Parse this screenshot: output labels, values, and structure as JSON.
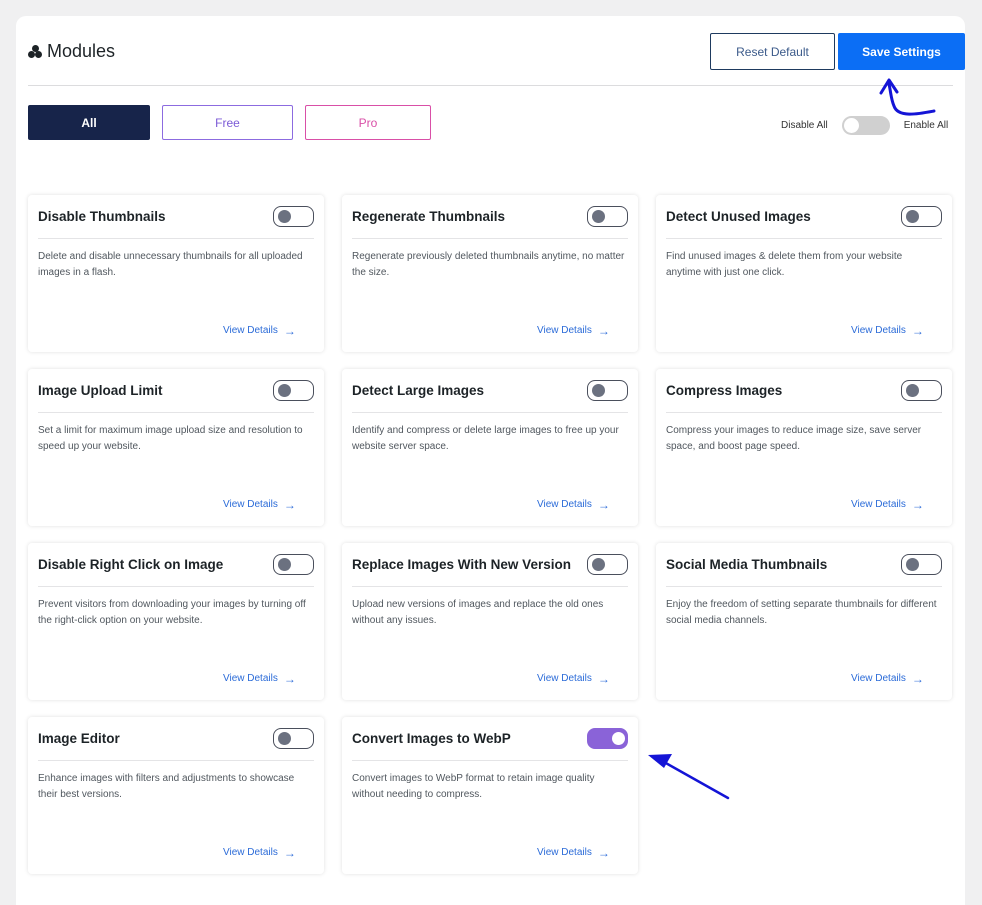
{
  "header": {
    "title": "Modules",
    "reset_label": "Reset Default",
    "save_label": "Save Settings"
  },
  "filters": {
    "all": "All",
    "free": "Free",
    "pro": "Pro"
  },
  "master_toggle": {
    "disable_label": "Disable All",
    "enable_label": "Enable All",
    "state": "off"
  },
  "modules": [
    {
      "title": "Disable Thumbnails",
      "desc": "Delete and disable unnecessary thumbnails for all uploaded images in a flash.",
      "link": "View Details",
      "enabled": false
    },
    {
      "title": "Regenerate Thumbnails",
      "desc": "Regenerate previously deleted thumbnails anytime, no matter the size.",
      "link": "View Details",
      "enabled": false
    },
    {
      "title": "Detect Unused Images",
      "desc": "Find unused images & delete them from your website anytime with just one click.",
      "link": "View Details",
      "enabled": false
    },
    {
      "title": "Image Upload Limit",
      "desc": "Set a limit for maximum image upload size and resolution to speed up your website.",
      "link": "View Details",
      "enabled": false
    },
    {
      "title": "Detect Large Images",
      "desc": "Identify and compress or delete large images to free up your website server space.",
      "link": "View Details",
      "enabled": false
    },
    {
      "title": "Compress Images",
      "desc": "Compress your images to reduce image size, save server space, and boost page speed.",
      "link": "View Details",
      "enabled": false
    },
    {
      "title": "Disable Right Click on Image",
      "desc": "Prevent visitors from downloading your images by turning off the right-click option on your website.",
      "link": "View Details",
      "enabled": false
    },
    {
      "title": "Replace Images With New Version",
      "desc": "Upload new versions of images and replace the old ones without any issues.",
      "link": "View Details",
      "enabled": false
    },
    {
      "title": "Social Media Thumbnails",
      "desc": "Enjoy the freedom of setting separate thumbnails for different social media channels.",
      "link": "View Details",
      "enabled": false
    },
    {
      "title": "Image Editor",
      "desc": "Enhance images with filters and adjustments to showcase their best versions.",
      "link": "View Details",
      "enabled": false
    },
    {
      "title": "Convert Images to WebP",
      "desc": "Convert images to WebP format to retain image quality without needing to compress.",
      "link": "View Details",
      "enabled": true
    }
  ],
  "colors": {
    "primary": "#0b6ef5",
    "dark": "#17244a",
    "free": "#7b59d6",
    "pro": "#d94fa7",
    "toggle_on": "#8a63d8",
    "link": "#2b6bd8",
    "annotation_arrow": "#1414d6"
  },
  "icons": {
    "title_icon": "modules-icon",
    "link_icon": "arrow-right-icon"
  }
}
